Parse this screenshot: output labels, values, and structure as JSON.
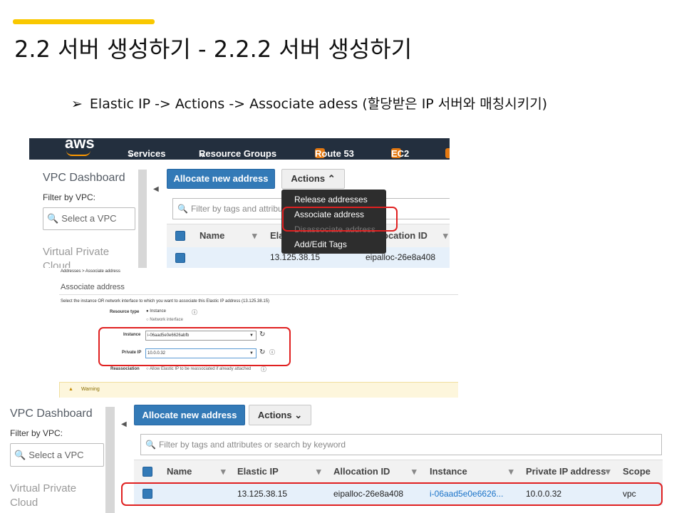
{
  "slide": {
    "title": "2.2 서버 생성하기 - 2.2.2 서버 생성하기",
    "bullet_marker": "➢",
    "bullet": "Elastic IP -> Actions -> Associate adess (할당받은 IP 서버와 매칭시키기)",
    "accent_color": "#f9c800",
    "highlight_color": "#e02020"
  },
  "shot1": {
    "logo": "aws",
    "nav": {
      "services": "Services",
      "resource_groups": "Resource Groups",
      "route53": "Route 53",
      "ec2": "EC2",
      "chevron": "⌄"
    },
    "sidebar": {
      "title": "VPC Dashboard",
      "filter_label": "Filter by VPC:",
      "select_placeholder": "Select a VPC",
      "section": "Virtual Private Cloud"
    },
    "allocate_button": "Allocate new address",
    "actions_button": "Actions",
    "actions_caret": "⌃",
    "search_placeholder": "Filter by tags and attribu",
    "columns": {
      "name": "Name",
      "elastic_ip": "Ela",
      "allocation_id": "ocation ID"
    },
    "row": {
      "elastic_ip": "13.125.38.15",
      "allocation_id": "eipalloc-26e8a408"
    },
    "menu": [
      "Release addresses",
      "Associate address",
      "Disassociate address",
      "Add/Edit Tags"
    ]
  },
  "shot2": {
    "breadcrumb": "Addresses > Associate address",
    "heading": "Associate address",
    "description": "Select the instance OR network interface to which you want to associate this Elastic IP address (13.125.38.15)",
    "resource_type_label": "Resource type",
    "option_instance": "Instance",
    "option_network": "Network interface",
    "instance_label": "Instance",
    "instance_value": "i-06aad5e0e6626abfb",
    "private_ip_label": "Private IP",
    "private_ip_value": "10.0.0.32",
    "reassociation_label": "Reassociation",
    "reassociation_text": "Allow Elastic IP to be reassociated if already attached",
    "warning": "Warning"
  },
  "shot3": {
    "sidebar": {
      "title": "VPC Dashboard",
      "filter_label": "Filter by VPC:",
      "select_placeholder": "Select a VPC",
      "section_line1": "Virtual Private",
      "section_line2": "Cloud"
    },
    "allocate_button": "Allocate new address",
    "actions_button": "Actions",
    "actions_caret": "⌄",
    "search_placeholder": "Filter by tags and attributes or search by keyword",
    "columns": [
      "Name",
      "Elastic IP",
      "Allocation ID",
      "Instance",
      "Private IP address",
      "Scope"
    ],
    "row": {
      "elastic_ip": "13.125.38.15",
      "allocation_id": "eipalloc-26e8a408",
      "instance": "i-06aad5e0e6626...",
      "private_ip": "10.0.0.32",
      "scope": "vpc"
    }
  }
}
